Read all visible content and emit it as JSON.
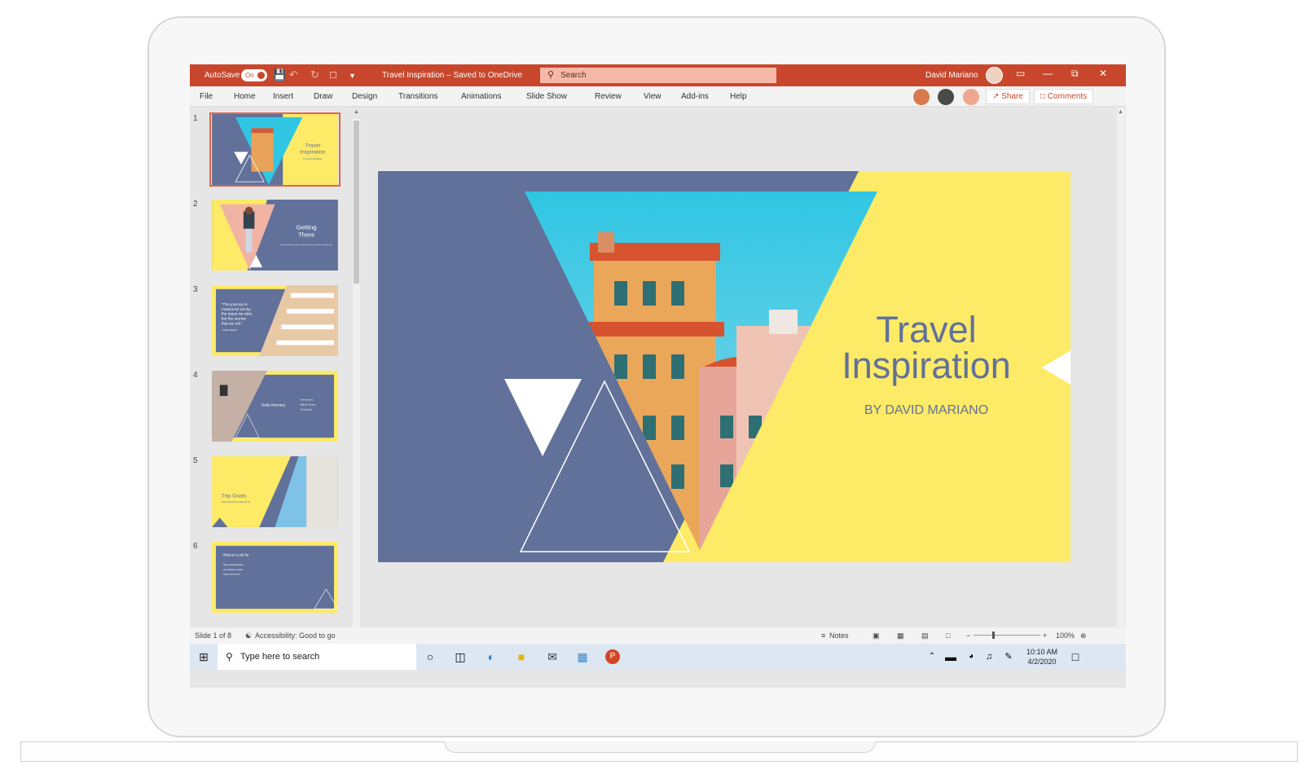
{
  "titlebar": {
    "autosave_label": "AutoSave",
    "autosave_state": "On",
    "doc_title": "Travel Inspiration – Saved to OneDrive",
    "search_placeholder": "Search",
    "user_name": "David Mariano"
  },
  "ribbon": {
    "tabs": [
      "File",
      "Home",
      "Insert",
      "Draw",
      "Design",
      "Transitions",
      "Animations",
      "Slide Show",
      "Review",
      "View",
      "Add-ins",
      "Help"
    ],
    "share_label": "Share",
    "comments_label": "Comments"
  },
  "thumbnails": {
    "numbers": [
      "1",
      "2",
      "3",
      "4",
      "5",
      "6"
    ],
    "slide1": {
      "title_line1": "Travel",
      "title_line2": "Inspiration",
      "subtitle": "BY DAVID MARIANO"
    },
    "slide2": {
      "title_line1": "Getting",
      "title_line2": "There",
      "body": "We checked most of the city by bike to see the sights along the way."
    },
    "slide3": {
      "quote_1": "“The journey is",
      "quote_2": "measured not by",
      "quote_3": "the steps we take,",
      "quote_4": "but the stories",
      "quote_5": "that we tell.”",
      "attribution": "– Author unknown"
    },
    "slide4": {
      "title": "Daily Itinerary",
      "bullets": [
        "Visit museums",
        "Walk the old town",
        "Try local food"
      ]
    },
    "slide5": {
      "title": "Trip Goals",
      "subtitle": "WHAT WE WANT TO SEE AND DO"
    },
    "slide6": {
      "title": "What to Look for",
      "bullets": [
        "Historic building designs",
        "Local artisans at market",
        "Unique cultural sites"
      ]
    }
  },
  "slide": {
    "title_line1": "Travel",
    "title_line2": "Inspiration",
    "subtitle": "BY DAVID MARIANO"
  },
  "statusbar": {
    "slide_count": "Slide 1 of 8",
    "accessibility": "Accessibility: Good to go",
    "notes": "Notes",
    "zoom": "100%"
  },
  "taskbar": {
    "search_placeholder": "Type here to search",
    "time": "10:10 AM",
    "date": "4/2/2020"
  },
  "colors": {
    "accent": "#c8472c",
    "slate": "#61719a",
    "yellow": "#fdea66",
    "sky": "#2fc6e3"
  }
}
